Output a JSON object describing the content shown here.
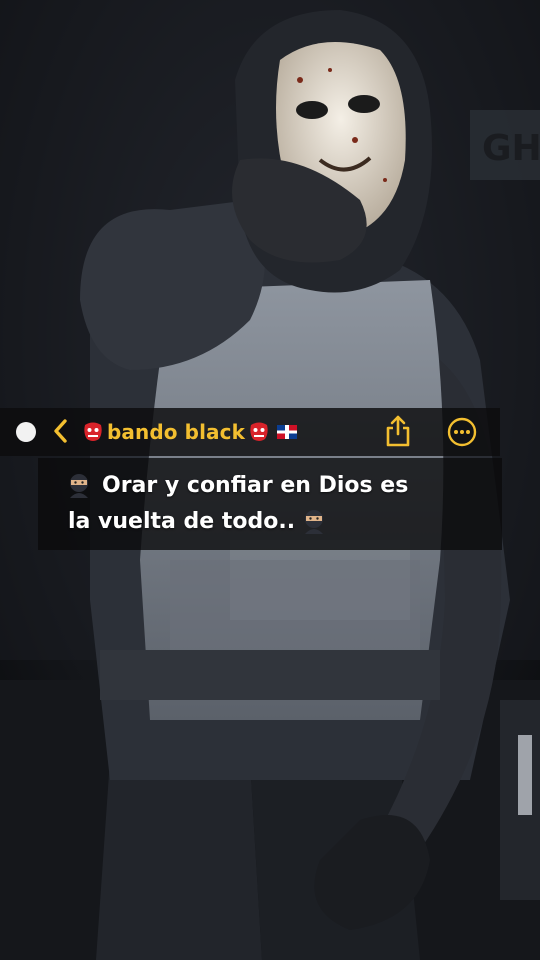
{
  "header": {
    "title": "bando black",
    "icons": [
      "goblin-mask-emoji",
      "goblin-mask-emoji",
      "dominican-flag-emoji",
      "back-chevron",
      "share-icon",
      "more-icon"
    ]
  },
  "message": {
    "line1": "Orar y confiar en Dios es",
    "line2": "la vuelta de todo..",
    "emoji": "ninja-emoji"
  },
  "colors": {
    "accent": "#f3bf30",
    "text": "#ffffff",
    "bar_bg": "#0c0c0e"
  }
}
